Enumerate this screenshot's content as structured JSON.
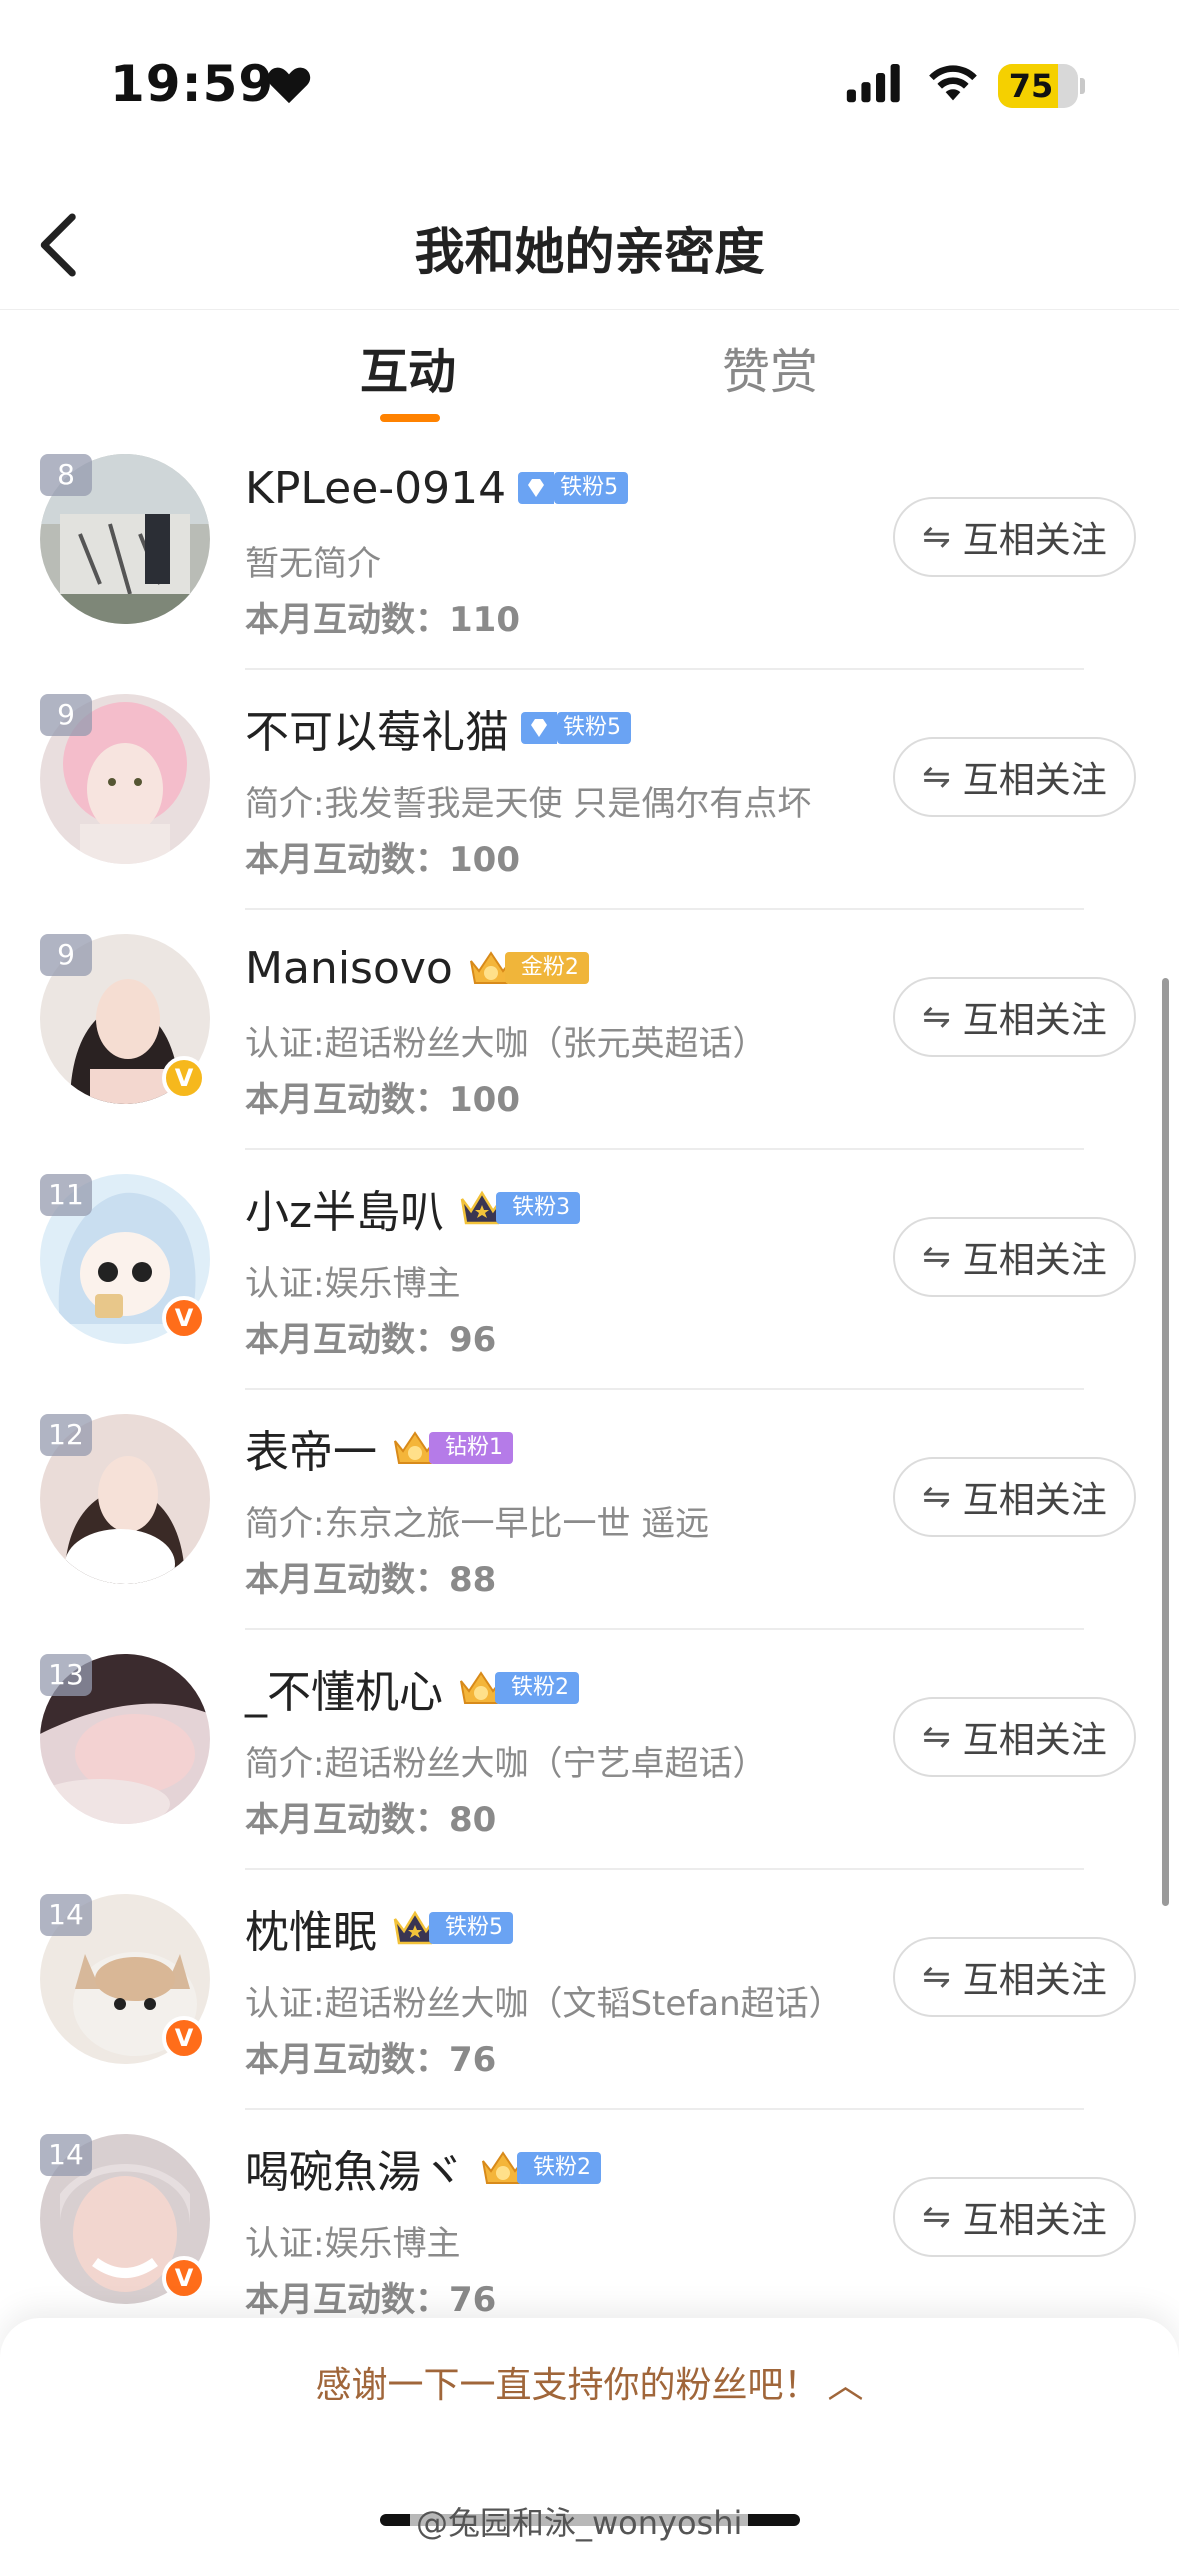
{
  "status_bar": {
    "time": "19:59",
    "battery": "75",
    "heart_icon": "heart-icon",
    "signal_icon": "cellular-signal-icon",
    "wifi_icon": "wifi-icon"
  },
  "header": {
    "title": "我和她的亲密度",
    "back_icon": "back-arrow-icon"
  },
  "tabs": [
    {
      "label": "互动",
      "active": true
    },
    {
      "label": "赞赏",
      "active": false
    }
  ],
  "colors": {
    "accent": "#ff8200",
    "thanks_text": "#a0663a",
    "fan_blue": "#6aa3f3",
    "fan_gold": "#f0b53a",
    "fan_purple": "#b57be8",
    "verified_gold": "#f6b81d",
    "verified_orange": "#ff6d1a"
  },
  "items": [
    {
      "rank": "8",
      "name": "KPLee-0914",
      "fan_label": "铁粉5",
      "fan_type": "diamond",
      "bio": "暂无简介",
      "count_label": "本月互动数：",
      "count": "110",
      "follow": "互相关注",
      "verified": ""
    },
    {
      "rank": "9",
      "name": "不可以莓礼猫",
      "fan_label": "铁粉5",
      "fan_type": "diamond",
      "bio": "简介:我发誓我是天使 只是偶尔有点坏",
      "count_label": "本月互动数：",
      "count": "100",
      "follow": "互相关注",
      "verified": ""
    },
    {
      "rank": "9",
      "name": "Manisovo",
      "fan_label": "金粉2",
      "fan_type": "gold",
      "bio": "认证:超话粉丝大咖（张元英超话）",
      "count_label": "本月互动数：",
      "count": "100",
      "follow": "互相关注",
      "verified": "gold"
    },
    {
      "rank": "11",
      "name": "小z半島叭",
      "fan_label": "铁粉3",
      "fan_type": "crown",
      "bio": "认证:娱乐博主",
      "count_label": "本月互动数：",
      "count": "96",
      "follow": "互相关注",
      "verified": "orange"
    },
    {
      "rank": "12",
      "name": "表帝一",
      "fan_label": "钻粉1",
      "fan_type": "purple",
      "bio": "简介:东京之旅一早比一世 遥远",
      "count_label": "本月互动数：",
      "count": "88",
      "follow": "互相关注",
      "verified": ""
    },
    {
      "rank": "13",
      "name": "_不懂机心",
      "fan_label": "铁粉2",
      "fan_type": "gold-crown",
      "bio": "简介:超话粉丝大咖（宁艺卓超话）",
      "count_label": "本月互动数：",
      "count": "80",
      "follow": "互相关注",
      "verified": ""
    },
    {
      "rank": "14",
      "name": "枕惟眠",
      "fan_label": "铁粉5",
      "fan_type": "crown",
      "bio": "认证:超话粉丝大咖（文韬Stefan超话）",
      "count_label": "本月互动数：",
      "count": "76",
      "follow": "互相关注",
      "verified": "orange"
    },
    {
      "rank": "14",
      "name": "喝碗魚湯ヾ",
      "fan_label": "铁粉2",
      "fan_type": "gold-crown",
      "bio": "认证:娱乐博主",
      "count_label": "本月互动数：",
      "count": "76",
      "follow": "互相关注",
      "verified": "orange"
    }
  ],
  "bottom": {
    "thanks": "感谢一下一直支持你的粉丝吧！",
    "watermark": "@兔园和泳_wonyoshi"
  }
}
